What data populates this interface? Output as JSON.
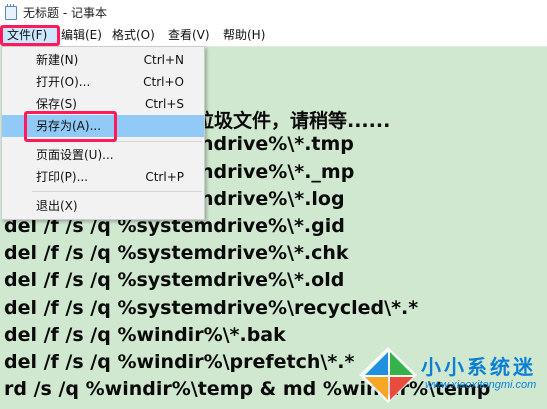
{
  "window": {
    "title": "无标题 - 记事本"
  },
  "menubar": {
    "items": [
      "文件(F)",
      "编辑(E)",
      "格式(O)",
      "查看(V)",
      "帮助(H)"
    ]
  },
  "file_menu": {
    "items": [
      {
        "label": "新建(N)",
        "shortcut": "Ctrl+N"
      },
      {
        "label": "打开(O)...",
        "shortcut": "Ctrl+O"
      },
      {
        "label": "保存(S)",
        "shortcut": "Ctrl+S"
      },
      {
        "label": "另存为(A)...",
        "shortcut": ""
      },
      {
        "label": "页面设置(U)...",
        "shortcut": ""
      },
      {
        "label": "打印(P)...",
        "shortcut": "Ctrl+P"
      },
      {
        "label": "退出(X)",
        "shortcut": ""
      }
    ],
    "highlighted": "另存为(A)..."
  },
  "editor": {
    "lines": [
      "垃圾文件，请稍等......",
      "ndrive%\\*.tmp",
      "ndrive%\\*._mp",
      "ndrive%\\*.log",
      "del /f /s /q %systemdrive%\\*.gid",
      "del /f /s /q %systemdrive%\\*.chk",
      "del /f /s /q %systemdrive%\\*.old",
      "del /f /s /q %systemdrive%\\recycled\\*.*",
      "del /f /s /q %windir%\\*.bak",
      "del /f /s /q %windir%\\prefetch\\*.*",
      "rd /s /q %windir%\\temp & md %windir%\\temp"
    ]
  },
  "watermark": {
    "title": "小小系统迷",
    "url": "www.xiaoxitongmi.com"
  },
  "colors": {
    "editor_bg": "#cfe8cf",
    "highlight_box": "#ff1a5a",
    "menu_hover": "#91c9f7",
    "watermark": "#0b7fd6"
  }
}
